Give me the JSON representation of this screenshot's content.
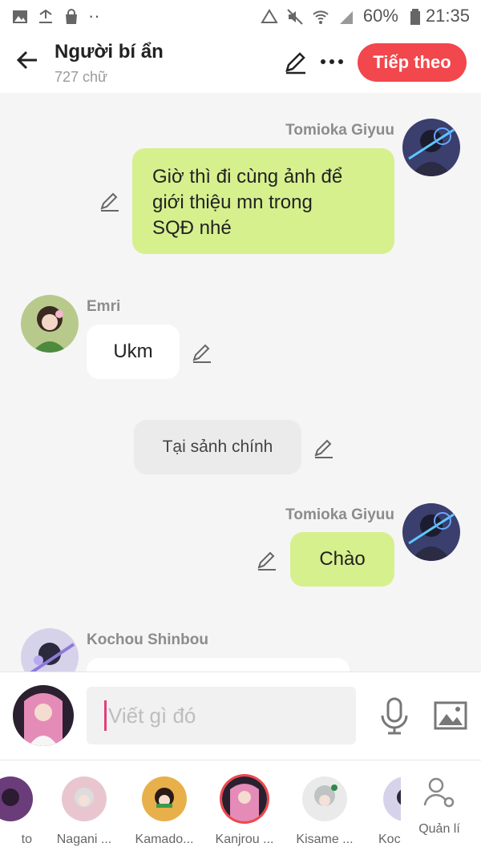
{
  "status_bar": {
    "battery": "60%",
    "time": "21:35"
  },
  "header": {
    "title": "Người bí ẩn",
    "subtitle": "727 chữ",
    "next_label": "Tiếp theo"
  },
  "messages": [
    {
      "sender": "Tomioka Giyuu",
      "text_lines": [
        "Giờ thì đi cùng ảnh để",
        "giới thiệu mn trong",
        "SQĐ nhé"
      ]
    },
    {
      "sender": "Emri",
      "text": "Ukm"
    },
    {
      "narration": "Tại sảnh chính"
    },
    {
      "sender": "Tomioka Giyuu",
      "text": "Chào"
    },
    {
      "sender": "Kochou Shinbou"
    }
  ],
  "input": {
    "placeholder": "Viết gì đó"
  },
  "characters": [
    {
      "name": "to"
    },
    {
      "name": "Nagani ..."
    },
    {
      "name": "Kamado..."
    },
    {
      "name": "Kanjrou ..."
    },
    {
      "name": "Kisame ..."
    },
    {
      "name": "Koc"
    }
  ],
  "manage_label": "Quản lí",
  "colors": {
    "accent": "#f1474d",
    "bubble_green": "#d6f08e",
    "bubble_white": "#ffffff",
    "narration_gray": "#ebebeb"
  },
  "icons": [
    "back-arrow-icon",
    "pencil-icon",
    "more-icon",
    "mic-icon",
    "image-icon",
    "manage-user-icon"
  ]
}
